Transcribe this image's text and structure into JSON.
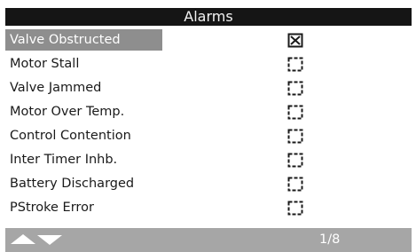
{
  "screen": {
    "title": "Alarms"
  },
  "alarms": [
    {
      "label": "Valve Obstructed",
      "active": true,
      "selected": true
    },
    {
      "label": "Motor Stall",
      "active": false,
      "selected": false
    },
    {
      "label": "Valve Jammed",
      "active": false,
      "selected": false
    },
    {
      "label": "Motor Over Temp.",
      "active": false,
      "selected": false
    },
    {
      "label": "Control Contention",
      "active": false,
      "selected": false
    },
    {
      "label": "Inter Timer Inhb.",
      "active": false,
      "selected": false
    },
    {
      "label": "Battery Discharged",
      "active": false,
      "selected": false
    },
    {
      "label": "PStroke Error",
      "active": false,
      "selected": false
    }
  ],
  "footer": {
    "page_indicator": "1/8",
    "nav_icons": [
      "up-arrow-icon",
      "down-arrow-icon"
    ]
  },
  "colors": {
    "title_bg": "#151515",
    "selection_bg": "#8e8e8e",
    "footer_bg": "#a6a6a6",
    "text": "#1a1a1a"
  }
}
